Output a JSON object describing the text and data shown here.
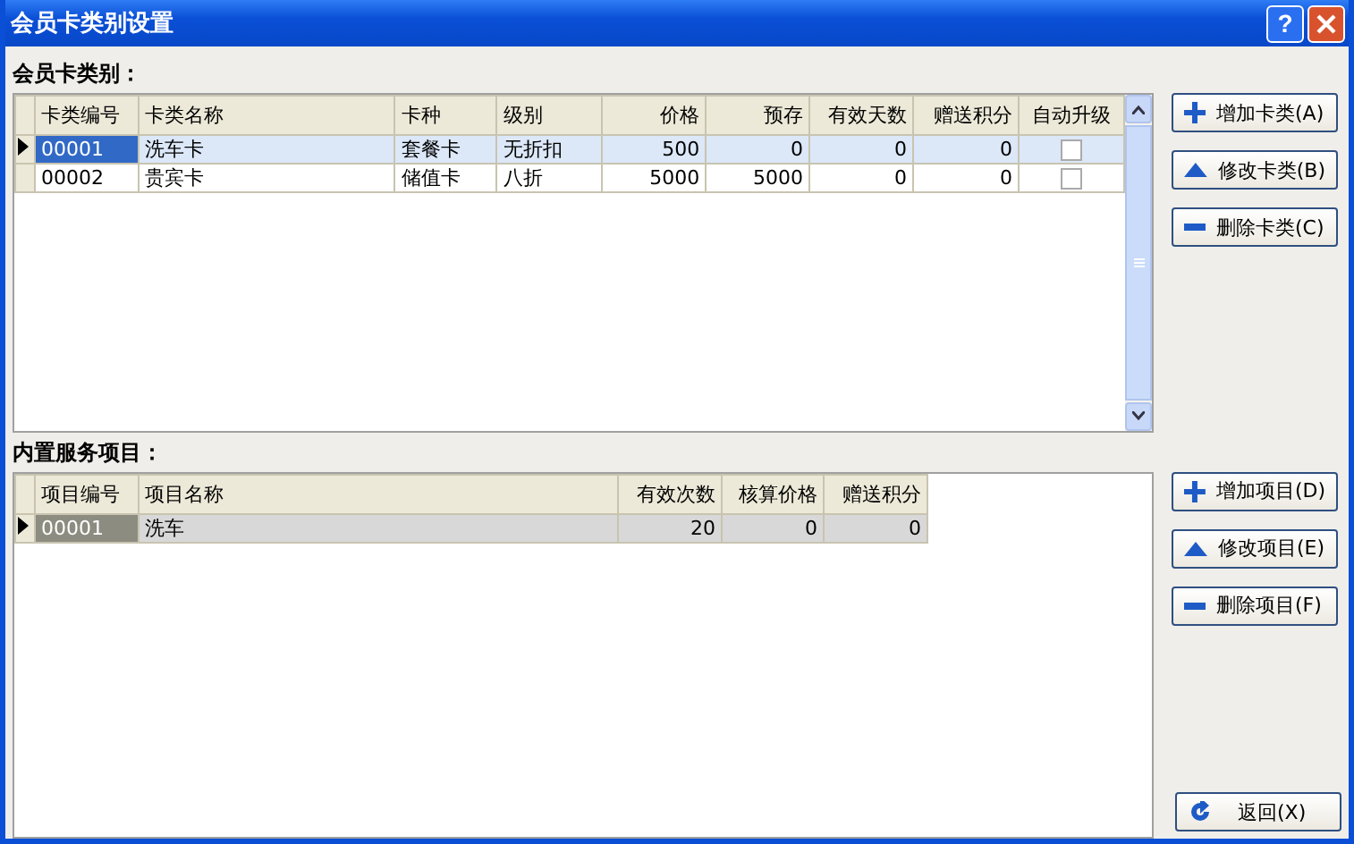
{
  "window": {
    "title": "会员卡类别设置",
    "help": "?"
  },
  "sections": [
    {
      "label": "会员卡类别：",
      "columns": [
        {
          "label": "卡类编号",
          "kind": "text"
        },
        {
          "label": "卡类名称",
          "kind": "text"
        },
        {
          "label": "卡种",
          "kind": "text"
        },
        {
          "label": "级别",
          "kind": "text"
        },
        {
          "label": "价格",
          "kind": "number"
        },
        {
          "label": "预存",
          "kind": "number"
        },
        {
          "label": "有效天数",
          "kind": "number"
        },
        {
          "label": "赠送积分",
          "kind": "number"
        },
        {
          "label": "自动升级",
          "kind": "check"
        }
      ],
      "rows": [
        {
          "selected": true,
          "cells": [
            {
              "kind": "text",
              "value": "00001"
            },
            {
              "kind": "text",
              "value": "洗车卡"
            },
            {
              "kind": "text",
              "value": "套餐卡"
            },
            {
              "kind": "text",
              "value": "无折扣"
            },
            {
              "kind": "text",
              "value": "500"
            },
            {
              "kind": "text",
              "value": "0"
            },
            {
              "kind": "text",
              "value": "0"
            },
            {
              "kind": "text",
              "value": "0"
            },
            {
              "kind": "check",
              "checked": false
            }
          ]
        },
        {
          "selected": false,
          "cells": [
            {
              "kind": "text",
              "value": "00002"
            },
            {
              "kind": "text",
              "value": "贵宾卡"
            },
            {
              "kind": "text",
              "value": "储值卡"
            },
            {
              "kind": "text",
              "value": "八折"
            },
            {
              "kind": "text",
              "value": "5000"
            },
            {
              "kind": "text",
              "value": "5000"
            },
            {
              "kind": "text",
              "value": "0"
            },
            {
              "kind": "text",
              "value": "0"
            },
            {
              "kind": "check",
              "checked": false
            }
          ]
        }
      ],
      "buttons": [
        {
          "kind": "add",
          "label": "增加卡类(A)"
        },
        {
          "kind": "edit",
          "label": "修改卡类(B)"
        },
        {
          "kind": "delete",
          "label": "删除卡类(C)"
        }
      ]
    },
    {
      "label": "内置服务项目：",
      "columns": [
        {
          "label": "项目编号",
          "kind": "text"
        },
        {
          "label": "项目名称",
          "kind": "text"
        },
        {
          "label": "有效次数",
          "kind": "number"
        },
        {
          "label": "核算价格",
          "kind": "number"
        },
        {
          "label": "赠送积分",
          "kind": "number"
        }
      ],
      "rows": [
        {
          "selected": true,
          "cells": [
            {
              "kind": "text",
              "value": "00001"
            },
            {
              "kind": "text",
              "value": "洗车"
            },
            {
              "kind": "text",
              "value": "20"
            },
            {
              "kind": "text",
              "value": "0"
            },
            {
              "kind": "text",
              "value": "0"
            }
          ]
        }
      ],
      "buttons": [
        {
          "kind": "add",
          "label": "增加项目(D)"
        },
        {
          "kind": "edit",
          "label": "修改项目(E)"
        },
        {
          "kind": "delete",
          "label": "删除项目(F)"
        }
      ]
    }
  ],
  "footer_button": {
    "kind": "back",
    "label": "返回(X)"
  }
}
